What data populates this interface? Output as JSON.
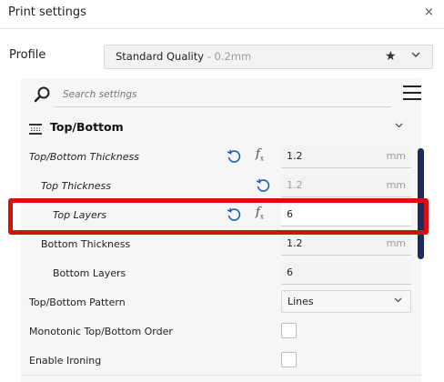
{
  "window": {
    "title": "Print settings",
    "close_glyph": "×"
  },
  "profile": {
    "label": "Profile",
    "name": "Standard Quality",
    "quality": " - 0.2mm",
    "favorite_icon": "star-icon",
    "dropdown_icon": "chevron-down-icon"
  },
  "search": {
    "placeholder": "Search settings",
    "icon": "search-icon",
    "menu_icon": "hamburger-menu-icon"
  },
  "category": {
    "title": "Top/Bottom",
    "icon": "top-bottom-category-icon",
    "collapse_glyph": "⌄"
  },
  "fx_label": "f",
  "fx_sub": "x",
  "rows": [
    {
      "label": "Top/Bottom Thickness",
      "value": "1.2",
      "unit": "mm"
    },
    {
      "label": "Top Thickness",
      "value": "1.2",
      "unit": "mm"
    },
    {
      "label": "Top Layers",
      "value": "6",
      "unit": ""
    },
    {
      "label": "Bottom Thickness",
      "value": "1.2",
      "unit": "mm"
    },
    {
      "label": "Bottom Layers",
      "value": "6",
      "unit": ""
    },
    {
      "label": "Top/Bottom Pattern",
      "value": "Lines",
      "unit": ""
    },
    {
      "label": "Monotonic Top/Bottom Order",
      "value": "",
      "unit": ""
    },
    {
      "label": "Enable Ironing",
      "value": "",
      "unit": ""
    }
  ],
  "colors": {
    "highlight": "#dc0d0d",
    "scrollbar": "#1e2a63",
    "reset_icon": "#1a5fb4"
  }
}
